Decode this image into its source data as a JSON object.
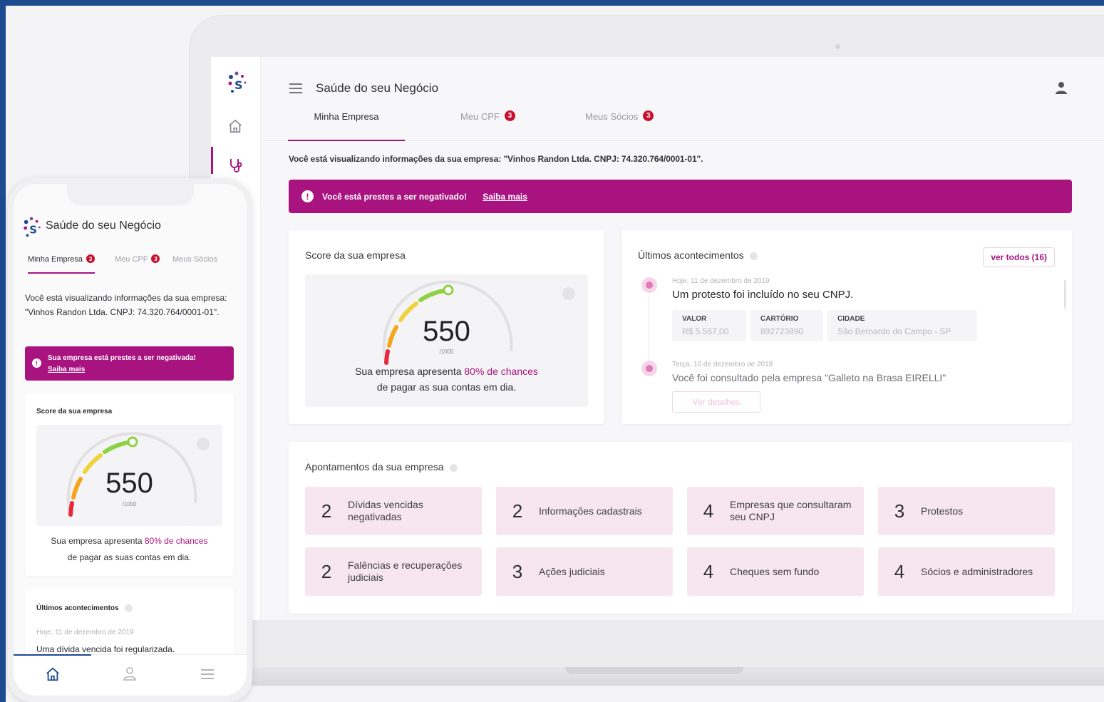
{
  "app": {
    "title": "Saúde do seu Negócio",
    "accent_color": "#a8137f",
    "frame_color": "#1d4b8f"
  },
  "desktop": {
    "tabs": [
      {
        "label": "Minha Empresa",
        "badge": ""
      },
      {
        "label": "Meu CPF",
        "badge": "3"
      },
      {
        "label": "Meus Sócios",
        "badge": "3"
      }
    ],
    "viewing_text": "Você está visualizando informações da sua empresa: \"Vinhos Randon Ltda. CNPJ: 74.320.764/0001-01\".",
    "alert": {
      "text": "Você está prestes a ser negativado!",
      "link": "Saiba mais",
      "icon": "!"
    },
    "score": {
      "title": "Score da sua empresa",
      "value": "550",
      "denominator": "/1000",
      "desc_prefix": "Sua empresa apresenta",
      "desc_highlight": "80% de chances",
      "desc_suffix": "de pagar as sua contas em dia."
    },
    "events": {
      "title": "Últimos acontecimentos",
      "view_all": "ver todos (16)",
      "items": [
        {
          "date": "Hoje, 11 de dezembro de 2019",
          "text": "Um protesto foi incluído no seu CNPJ.",
          "fields": [
            {
              "label": "VALOR",
              "value": "R$ 5.567,00"
            },
            {
              "label": "CARTÓRIO",
              "value": "892723890"
            },
            {
              "label": "CIDADE",
              "value": "São Bernardo do Campo - SP"
            }
          ]
        },
        {
          "date": "Terça, 10 de dezembro de 2019",
          "text": "Você foi consultado pela empresa \"Galleto na Brasa EIRELLI\"",
          "button": "Ver detalhes"
        }
      ]
    },
    "apontamentos": {
      "title": "Apontamentos da sua empresa",
      "items": [
        {
          "count": "2",
          "label": "Dívidas vencidas negativadas"
        },
        {
          "count": "2",
          "label": "Informações cadastrais"
        },
        {
          "count": "4",
          "label": "Empresas que consultaram seu CNPJ"
        },
        {
          "count": "3",
          "label": "Protestos"
        },
        {
          "count": "2",
          "label": "Falências e recuperações judiciais"
        },
        {
          "count": "3",
          "label": "Ações judiciais"
        },
        {
          "count": "4",
          "label": "Cheques sem fundo"
        },
        {
          "count": "4",
          "label": "Sócios e administradores"
        }
      ]
    }
  },
  "mobile": {
    "tabs": [
      {
        "label": "Minha Empresa",
        "badge": "3"
      },
      {
        "label": "Meu CPF",
        "badge": "3"
      },
      {
        "label": "Meus Sócios",
        "badge": ""
      }
    ],
    "viewing_text": "Você está visualizando informações da sua empresa: \"Vinhos Randon Ltda. CNPJ: 74.320.764/0001-01\".",
    "alert": {
      "text": "Sua empresa está prestes a ser negativada!",
      "link": "Saiba mais",
      "icon": "!"
    },
    "score": {
      "title": "Score da sua empresa",
      "value": "550",
      "denominator": "/1000",
      "desc_prefix": "Sua empresa apresenta",
      "desc_highlight": "80% de chances",
      "desc_suffix": "de pagar as suas contas em dia."
    },
    "events": {
      "title": "Últimos acontecimentos",
      "date": "Hoje, 11 de dezembro de 2019",
      "text": "Uma dívida vencida foi regularizada."
    }
  }
}
